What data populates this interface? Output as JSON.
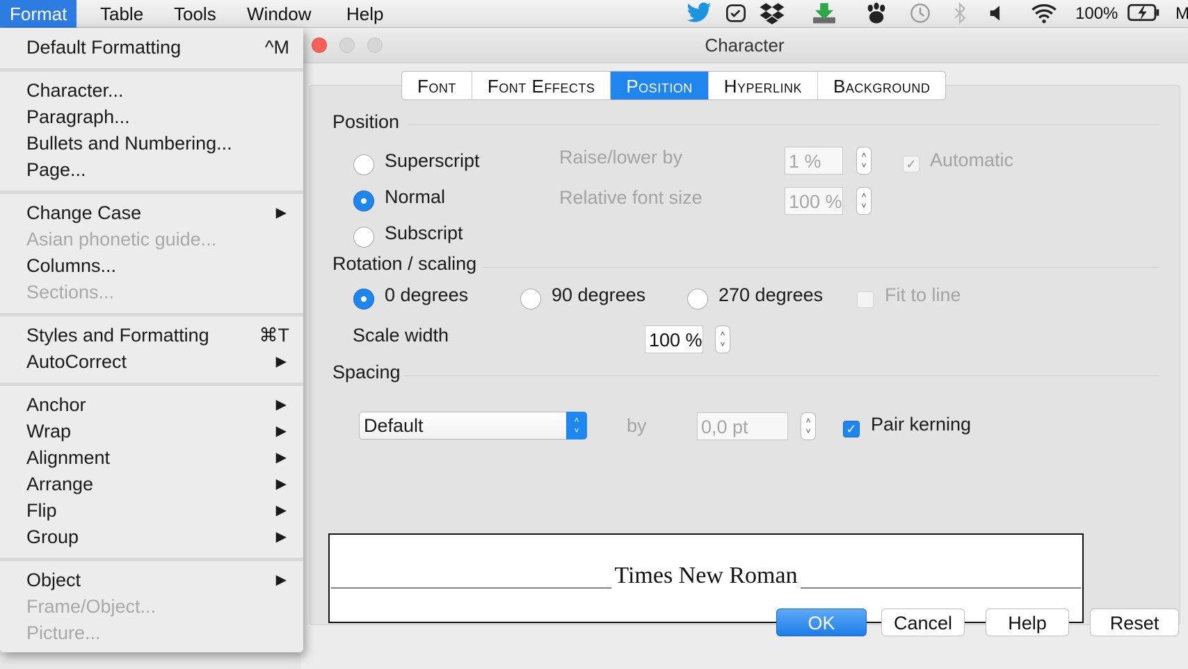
{
  "menubar": {
    "items": [
      "Format",
      "Table",
      "Tools",
      "Window",
      "Help"
    ],
    "battery": "100%",
    "user_initial": "M",
    "tray_icons": [
      "twitter-icon",
      "todo-icon",
      "dropbox-icon",
      "download-icon",
      "paw-icon",
      "time-machine-icon",
      "bluetooth-icon",
      "volume-icon",
      "wifi-icon",
      "battery-icon"
    ]
  },
  "format_menu": {
    "default_formatting": {
      "label": "Default Formatting",
      "shortcut": "^M"
    },
    "group1": [
      "Character...",
      "Paragraph...",
      "Bullets and Numbering...",
      "Page..."
    ],
    "group2": {
      "change_case": "Change Case",
      "asian_phonetic": "Asian phonetic guide...",
      "columns": "Columns...",
      "sections": "Sections..."
    },
    "group3": {
      "styles": {
        "label": "Styles and Formatting",
        "shortcut": "⌘T"
      },
      "autocorrect": "AutoCorrect"
    },
    "group4": [
      "Anchor",
      "Wrap",
      "Alignment",
      "Arrange",
      "Flip",
      "Group"
    ],
    "group5": {
      "object": "Object",
      "frame_object": "Frame/Object...",
      "picture": "Picture..."
    }
  },
  "dialog": {
    "title": "Character",
    "tabs": [
      "Font",
      "Font Effects",
      "Position",
      "Hyperlink",
      "Background"
    ],
    "active_tab": "Position",
    "position": {
      "section": "Position",
      "superscript": "Superscript",
      "normal": "Normal",
      "subscript": "Subscript",
      "raise_lower_label": "Raise/lower by",
      "raise_lower_value": "1 %",
      "relative_size_label": "Relative font size",
      "relative_size_value": "100 %",
      "automatic": "Automatic"
    },
    "rotation": {
      "section": "Rotation / scaling",
      "deg0": "0 degrees",
      "deg90": "90 degrees",
      "deg270": "270 degrees",
      "fit_to_line": "Fit to line",
      "scale_width_label": "Scale width",
      "scale_width_value": "100 %"
    },
    "spacing": {
      "section": "Spacing",
      "mode": "Default",
      "by_label": "by",
      "by_value": "0,0 pt",
      "pair_kerning": "Pair kerning"
    },
    "preview_text": "Times New Roman",
    "buttons": {
      "ok": "OK",
      "cancel": "Cancel",
      "help": "Help",
      "reset": "Reset"
    }
  },
  "colors": {
    "accent": "#1f86f0",
    "menu_highlight": "#2d7ce2"
  }
}
